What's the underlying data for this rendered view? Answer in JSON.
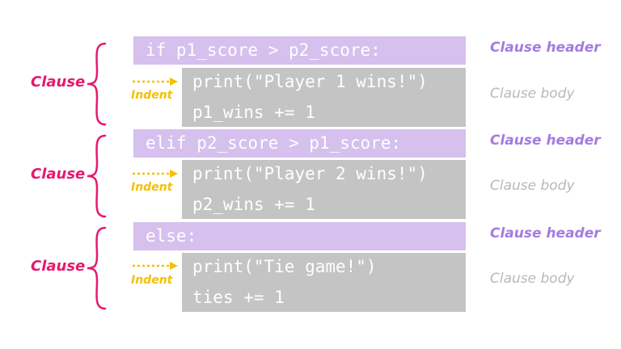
{
  "colors": {
    "header_bg": "#d5c0ee",
    "body_bg": "#c4c4c4",
    "code_text": "#ffffff",
    "clause": "#e6196e",
    "clause_header": "#a37ce0",
    "clause_body": "#b8b8b8",
    "indent": "#f5c000"
  },
  "labels": {
    "clause": "Clause",
    "clause_header": "Clause header",
    "clause_body": "Clause body",
    "indent": "Indent"
  },
  "clauses": [
    {
      "header": "if p1_score > p2_score:",
      "body": [
        "print(\"Player 1 wins!\")",
        "p1_wins += 1"
      ]
    },
    {
      "header": "elif p2_score > p1_score:",
      "body": [
        "print(\"Player 2 wins!\")",
        "p2_wins += 1"
      ]
    },
    {
      "header": "else:",
      "body": [
        "print(\"Tie game!\")",
        "ties += 1"
      ]
    }
  ]
}
